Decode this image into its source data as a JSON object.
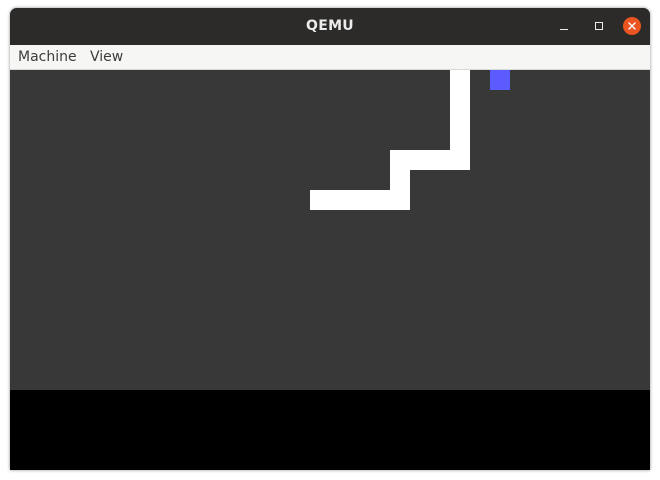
{
  "window": {
    "title": "QEMU",
    "controls": {
      "minimize_icon": "minimize-icon",
      "maximize_icon": "maximize-icon",
      "close_icon": "close-icon",
      "close_color": "#e95420"
    }
  },
  "menubar": {
    "items": [
      {
        "label": "Machine"
      },
      {
        "label": "View"
      }
    ]
  },
  "guest_screen": {
    "background": "#383838",
    "status_band_color": "#000000",
    "snake_color": "#ffffff",
    "food_color": "#5b5bff"
  }
}
